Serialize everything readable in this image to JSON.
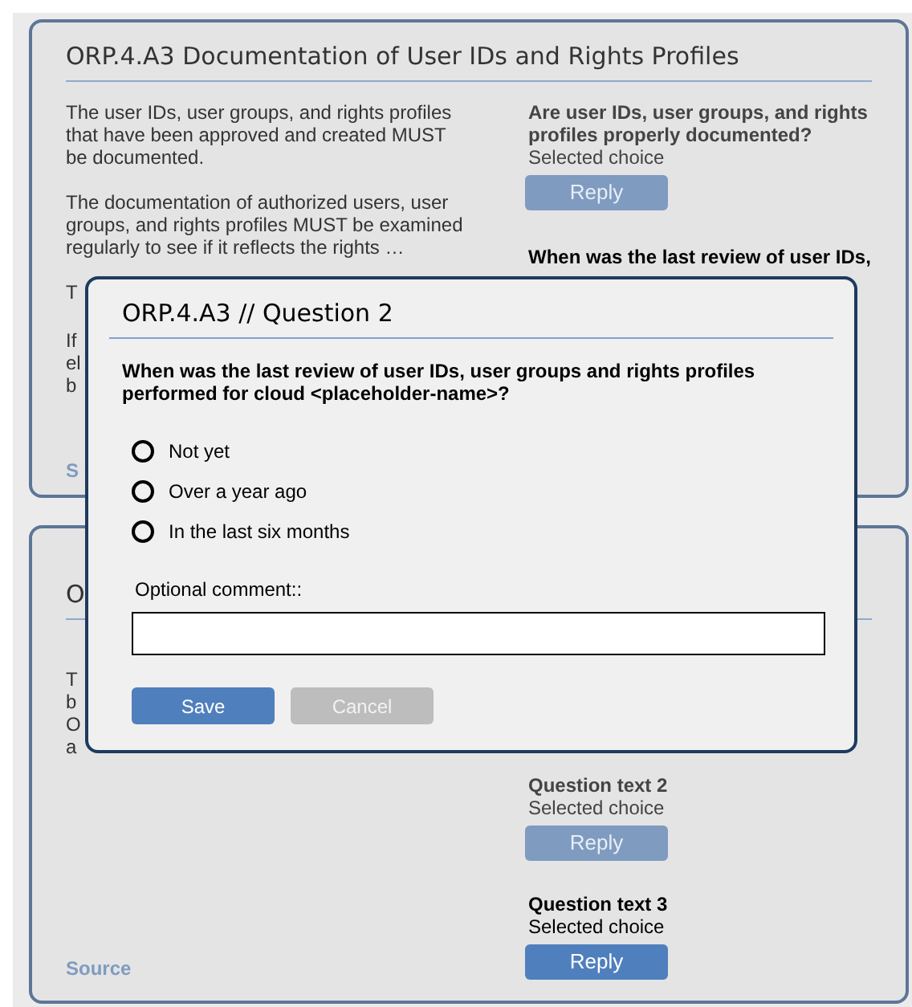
{
  "cards": [
    {
      "title": "ORP.4.A3 Documentation of User IDs and Rights Profiles",
      "paragraphs": [
        "The user IDs, user groups, and rights profiles that have been approved and created MUST be documented.",
        "The documentation of authorized users, user groups, and rights profiles MUST be examined regularly to see if it reflects the rights …"
      ],
      "fragments": [
        {
          "lines": [
            "T"
          ]
        },
        {
          "lines": [
            "If",
            "el",
            "b"
          ]
        }
      ],
      "source": "S",
      "questions": [
        {
          "text": "Are user IDs, user groups, and rights profiles properly documented?",
          "choice": "Selected choice",
          "reply": {
            "label": "Reply",
            "disabled": true
          }
        },
        {
          "text": "When was the last review of user IDs,"
        }
      ]
    },
    {
      "title": "O",
      "fragments": [
        {
          "lines": [
            "T",
            "b",
            "O",
            "a"
          ]
        }
      ],
      "source": "Source",
      "questions": [
        {
          "text": "Question text 2",
          "choice": "Selected choice",
          "reply": {
            "label": "Reply",
            "disabled": true
          }
        },
        {
          "text": "Question text 3",
          "choice": "Selected choice",
          "reply": {
            "label": "Reply",
            "disabled": false
          }
        }
      ]
    }
  ],
  "dialog": {
    "title": "ORP.4.A3 // Question 2",
    "question": "When was the last review of user IDs, user groups and rights profiles performed for cloud <placeholder-name>?",
    "options": [
      {
        "label": "Not yet",
        "selected": false
      },
      {
        "label": "Over a year ago",
        "selected": false
      },
      {
        "label": "In the last six months",
        "selected": false
      }
    ],
    "comment_label": "Optional comment::",
    "buttons": [
      {
        "label": "Save",
        "disabled": false
      },
      {
        "label": "Cancel",
        "disabled": true
      }
    ]
  }
}
